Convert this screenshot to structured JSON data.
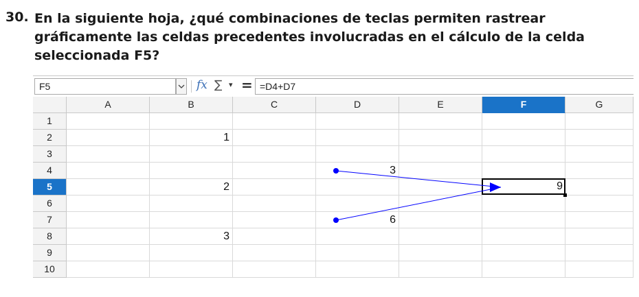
{
  "question": {
    "number": "30.",
    "text": "En la siguiente hoja, ¿qué combinaciones de teclas permiten rastrear gráficamente las celdas precedentes involucradas en el cálculo de la celda seleccionada F5?"
  },
  "toolbar": {
    "name_box": "F5",
    "formula": "=D4+D7",
    "icons": [
      "chevron-down-icon",
      "function-wizard-icon",
      "sum-icon",
      "dropdown-icon",
      "equals-icon"
    ],
    "fx_glyph": "fx",
    "sum_glyph": "∑",
    "dd_glyph": "▾",
    "eq_glyph": "="
  },
  "columns": [
    "A",
    "B",
    "C",
    "D",
    "E",
    "F",
    "G"
  ],
  "rows": [
    "1",
    "2",
    "3",
    "4",
    "5",
    "6",
    "7",
    "8",
    "9",
    "10"
  ],
  "selected": {
    "column": "F",
    "row": "5"
  },
  "cells": {
    "B2": "1",
    "B5": "2",
    "B8": "3",
    "D4": "3",
    "D7": "6",
    "F5": "9"
  },
  "trace_color": "#0000ff",
  "accent_color": "#1a73c8"
}
